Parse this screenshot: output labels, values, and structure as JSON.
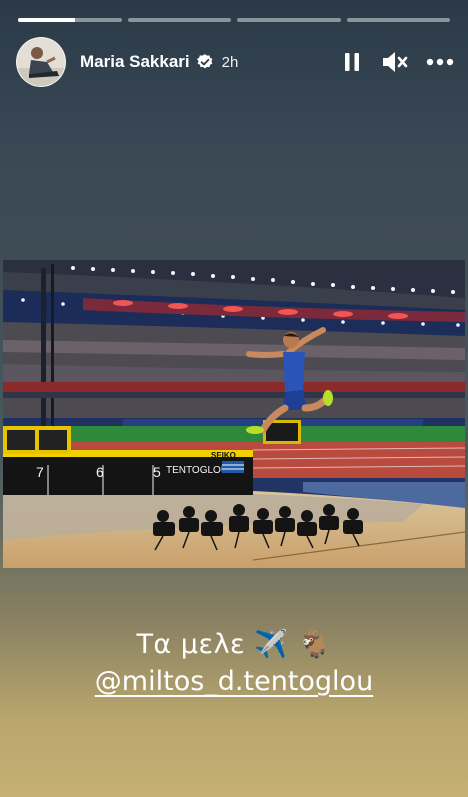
{
  "story": {
    "progress": [
      {
        "fill": 0.55
      },
      {
        "fill": 0
      },
      {
        "fill": 0
      },
      {
        "fill": 0
      }
    ],
    "author": "Maria Sakkari",
    "time": "2h",
    "icons": {
      "pause": "pause-icon",
      "mute": "speaker-muted-icon",
      "more": "more-horizontal-icon",
      "verified": "verified-badge-icon"
    },
    "photo": {
      "board_numbers": [
        "7",
        "6",
        "5"
      ],
      "board_name": "TENTOGLOU",
      "sponsor": "SEIKO"
    },
    "caption": {
      "line1": "Τα μελε ✈️ 🐐",
      "mention": "@miltos_d.tentoglou"
    }
  }
}
